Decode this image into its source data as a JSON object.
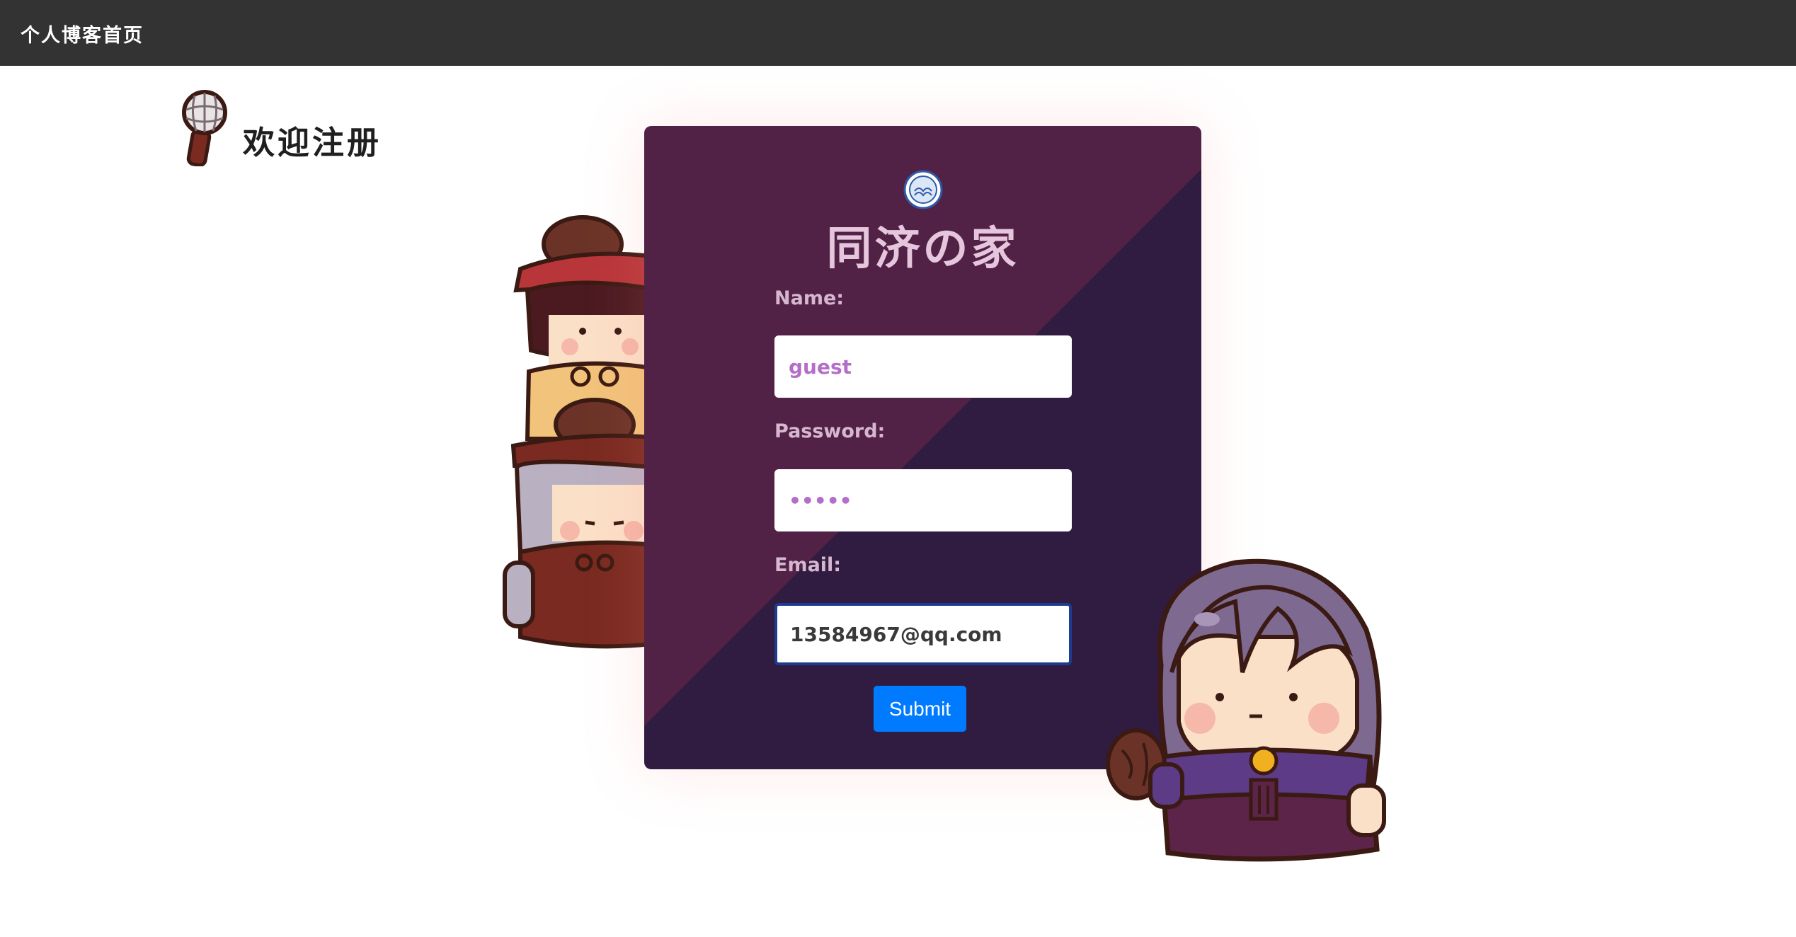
{
  "navbar": {
    "brand": "个人博客首页"
  },
  "page": {
    "heading": "欢迎注册"
  },
  "card": {
    "title": "同济の家",
    "logo_icon": "tongji-university-seal-icon"
  },
  "form": {
    "name_label": "Name:",
    "name_value": "guest",
    "password_label": "Password:",
    "password_value": "•••••",
    "email_label": "Email:",
    "email_value": "13584967@qq.com",
    "submit_label": "Submit"
  },
  "colors": {
    "navbar_bg": "#333333",
    "card_upper": "#512246",
    "card_lower": "#301c41",
    "button": "#007bff"
  }
}
